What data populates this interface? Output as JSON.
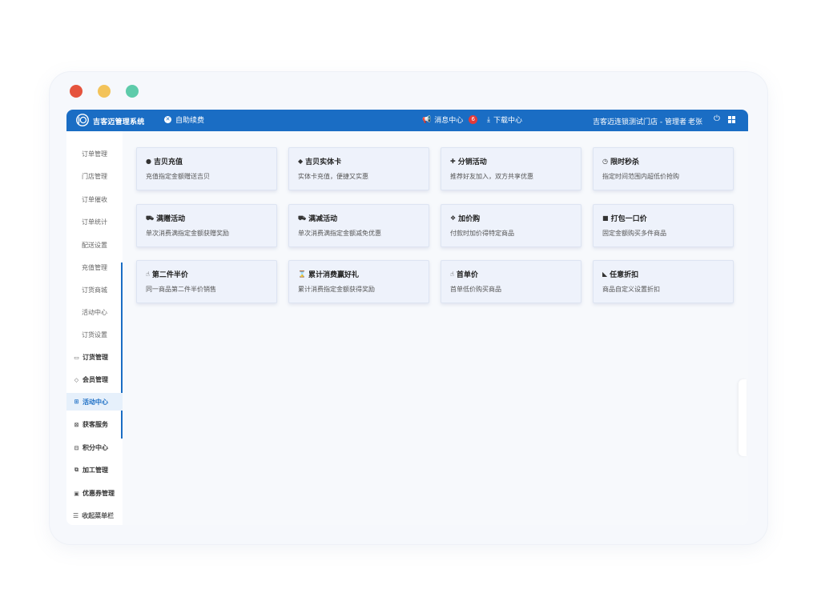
{
  "header": {
    "brand": "吉客迈管理系统",
    "selfpay": "自助续费",
    "messages": "消息中心",
    "message_count": "6",
    "download": "下载中心",
    "store": "吉客迈连锁测试门店 - 管理者",
    "user": "老张"
  },
  "sidebar": {
    "sub_items": [
      "订单管理",
      "门店管理",
      "订单催收",
      "订单统计",
      "配送设置",
      "充值管理",
      "订货商城",
      "活动中心",
      "订货设置"
    ],
    "main_items": [
      {
        "label": "订货管理",
        "icon": "cart-icon"
      },
      {
        "label": "会员管理",
        "icon": "member-icon"
      },
      {
        "label": "活动中心",
        "icon": "gift-icon"
      },
      {
        "label": "获客服务",
        "icon": "apps-icon"
      },
      {
        "label": "积分中心",
        "icon": "points-icon"
      },
      {
        "label": "加工管理",
        "icon": "process-icon"
      },
      {
        "label": "优惠券管理",
        "icon": "coupon-icon"
      }
    ],
    "collapse": "收起菜单栏"
  },
  "cards": [
    {
      "title": "吉贝充值",
      "desc": "充值指定金额赠送吉贝",
      "icon": "drop-icon"
    },
    {
      "title": "吉贝实体卡",
      "desc": "实体卡充值，便捷又实惠",
      "icon": "tag-icon"
    },
    {
      "title": "分销活动",
      "desc": "推荐好友加入，双方共享优惠",
      "icon": "user-plus-icon"
    },
    {
      "title": "限时秒杀",
      "desc": "指定时间范围内超低价抢购",
      "icon": "clock-icon"
    },
    {
      "title": "满赠活动",
      "desc": "单次消费满指定金额获赠奖励",
      "icon": "cart-icon"
    },
    {
      "title": "满减活动",
      "desc": "单次消费满指定金额减免优惠",
      "icon": "cart-icon"
    },
    {
      "title": "加价购",
      "desc": "付款时加价得特定商品",
      "icon": "cubes-icon"
    },
    {
      "title": "打包一口价",
      "desc": "固定金额购买多件商品",
      "icon": "box-icon"
    },
    {
      "title": "第二件半价",
      "desc": "同一商品第二件半价销售",
      "icon": "hand-icon"
    },
    {
      "title": "累计消费赢好礼",
      "desc": "累计消费指定金额获得奖励",
      "icon": "hourglass-icon"
    },
    {
      "title": "首单价",
      "desc": "首单低价购买商品",
      "icon": "hand-icon"
    },
    {
      "title": "任意折扣",
      "desc": "商品自定义设置折扣",
      "icon": "area-chart-icon"
    }
  ],
  "colors": {
    "primary": "#1a6dc4",
    "badge": "#e23a3a",
    "card_bg": "#eef2fb"
  }
}
